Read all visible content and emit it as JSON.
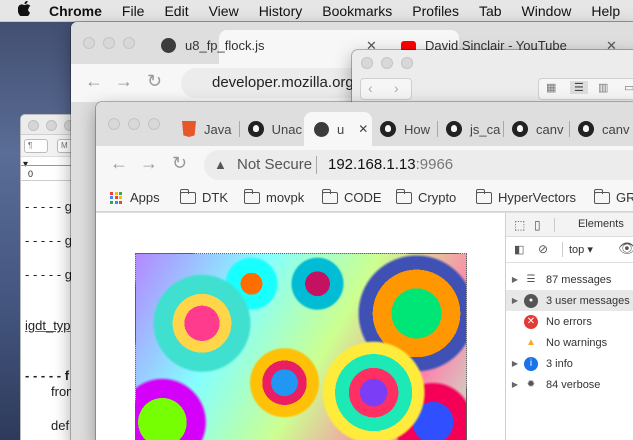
{
  "menubar": {
    "apple": "",
    "items": [
      "Chrome",
      "File",
      "Edit",
      "View",
      "History",
      "Bookmarks",
      "Profiles",
      "Tab",
      "Window",
      "Help"
    ]
  },
  "editor": {
    "toolbar_pill1": "¶",
    "toolbar_pill2": "M",
    "ruler_zero": "0",
    "lines": [
      "- - - - - g",
      "- - - - - g",
      "- - - - - g",
      "igdt_typ",
      "- - - - - f",
      "from",
      "def"
    ]
  },
  "win2": {
    "tab1": "u8_fp_flock.js",
    "tab2": "David Sinclair - YouTube",
    "address": "developer.mozilla.org"
  },
  "win1": {
    "tabs": [
      "Java",
      "Unac",
      "u",
      "How",
      "js_ca",
      "canv",
      "canv"
    ],
    "address_warning": "Not Secure",
    "address_host": "192.168.1.13",
    "address_port": ":9966",
    "bookmarks": [
      "Apps",
      "DTK",
      "movpk",
      "CODE",
      "Crypto",
      "HyperVectors",
      "GR"
    ]
  },
  "devtools": {
    "tab_elements": "Elements",
    "context": "top",
    "rows": [
      {
        "label": "87 messages",
        "icon": "list-icon",
        "color": "#555555",
        "expandable": true
      },
      {
        "label": "3 user messages",
        "icon": "user-icon",
        "color": "#555555",
        "expandable": true
      },
      {
        "label": "No errors",
        "icon": "error-icon",
        "color": "#e53935",
        "expandable": false
      },
      {
        "label": "No warnings",
        "icon": "warning-icon",
        "color": "#f9a825",
        "expandable": false
      },
      {
        "label": "3 info",
        "icon": "info-icon",
        "color": "#1a73e8",
        "expandable": true
      },
      {
        "label": "84 verbose",
        "icon": "gear-icon",
        "color": "#555555",
        "expandable": true
      }
    ]
  },
  "colors": {
    "youtube_red": "#ff0000",
    "accent_blue": "#1a73e8"
  }
}
